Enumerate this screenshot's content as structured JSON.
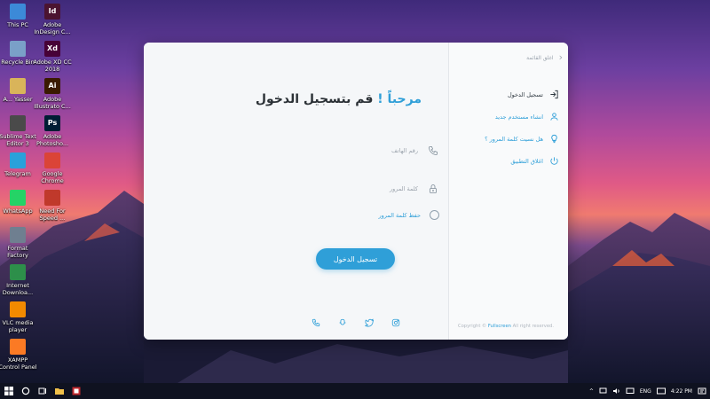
{
  "desktop": {
    "icons": [
      {
        "label": "This PC",
        "icon": "computer-icon",
        "color": "#3c8ad8"
      },
      {
        "label": "Adobe InDesign C...",
        "icon": "indesign-icon",
        "color": "#4b1430",
        "glyph": "Id"
      },
      {
        "label": "Recycle Bin",
        "icon": "recycle-bin-icon",
        "color": "#7aa0c8"
      },
      {
        "label": "Adobe XD CC 2018",
        "icon": "xd-icon",
        "color": "#470137",
        "glyph": "Xd"
      },
      {
        "label": "A... Yasser",
        "icon": "user-folder-icon",
        "color": "#d9b45a"
      },
      {
        "label": "Adobe Illustrato C...",
        "icon": "illustrator-icon",
        "color": "#3a1a00",
        "glyph": "Ai"
      },
      {
        "label": "Sublime Text Editor 3",
        "icon": "sublime-icon",
        "color": "#4a4a4a"
      },
      {
        "label": "Adobe Photosho...",
        "icon": "photoshop-icon",
        "color": "#001d34",
        "glyph": "Ps"
      },
      {
        "label": "Telegram",
        "icon": "telegram-icon",
        "color": "#2aa1da"
      },
      {
        "label": "Google Chrome",
        "icon": "chrome-icon",
        "color": "#db4437"
      },
      {
        "label": "WhatsApp",
        "icon": "whatsapp-icon",
        "color": "#25d366"
      },
      {
        "label": "Need For Speed ...",
        "icon": "nfs-icon",
        "color": "#c0392b"
      },
      {
        "label": "Format Factory",
        "icon": "format-factory-icon",
        "color": "#6f7f90"
      },
      {
        "label": "Internet Downloa...",
        "icon": "idm-icon",
        "color": "#2d8f4a"
      },
      {
        "label": "VLC media player",
        "icon": "vlc-icon",
        "color": "#f28a00"
      },
      {
        "label": "XAMPP Control Panel",
        "icon": "xampp-icon",
        "color": "#fb7a24"
      }
    ]
  },
  "app": {
    "close_label": "اغلق القائمة",
    "title_welcome": "مرحباً !",
    "title_rest": "قم بتسجيل الدخول",
    "phone_placeholder": "رقم الهاتف",
    "password_placeholder": "كلمة المرور",
    "remember_label": "حفظ كلمة المرور",
    "login_button": "تسجيل الدخول",
    "menu": [
      {
        "label": "تسجيل الدخول",
        "icon": "login-icon",
        "state": "active"
      },
      {
        "label": "انشاء مستخدم جديد",
        "icon": "add-user-icon",
        "state": "link"
      },
      {
        "label": "هل نسيت كلمة المرور ؟",
        "icon": "lightbulb-icon",
        "state": "link"
      },
      {
        "label": "اغلاق التطبيق",
        "icon": "power-icon",
        "state": "link"
      }
    ],
    "copyright_prefix": "Copyright ©",
    "copyright_brand": "Fullscreen",
    "copyright_suffix": "All right reserved.",
    "socials": [
      "phone-icon",
      "snapchat-icon",
      "twitter-icon",
      "instagram-icon"
    ],
    "accent": "#2f9fd8"
  },
  "taskbar": {
    "language": "ENG",
    "time": "4:22 PM"
  }
}
